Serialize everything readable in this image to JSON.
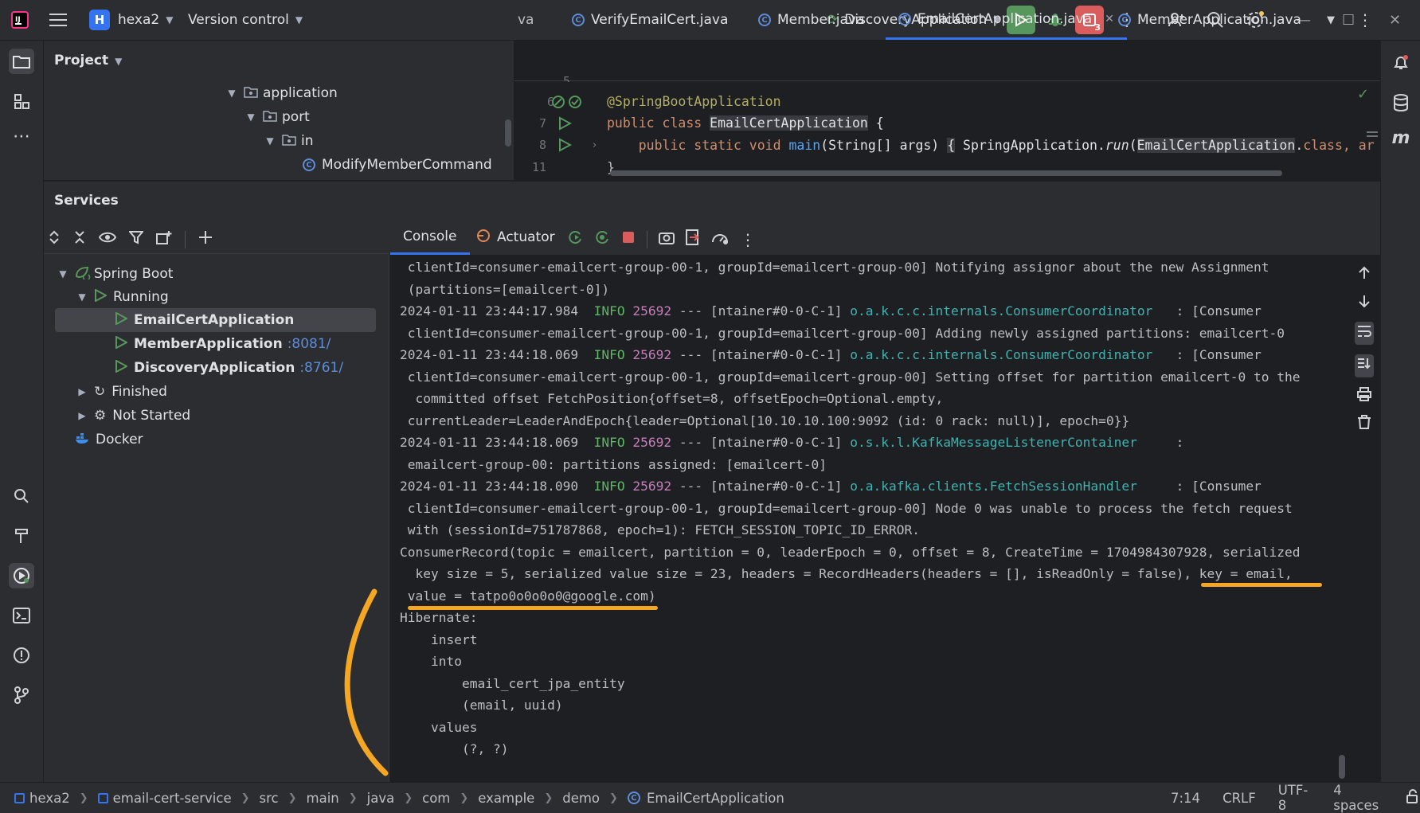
{
  "titlebar": {
    "project_letter": "H",
    "project_name": "hexa2",
    "vcs_label": "Version control",
    "run_config": "DiscoveryApplication",
    "stop_count": "3"
  },
  "project_panel": {
    "title": "Project",
    "rows": [
      "application",
      "port",
      "in",
      "ModifyMemberCommand"
    ]
  },
  "editor": {
    "tabs": [
      "va",
      "VerifyEmailCert.java",
      "Member.java",
      "EmailCertApplication.java",
      "MemberApplication.java"
    ],
    "line_numbers": [
      "5",
      "6",
      "7",
      "8",
      "11"
    ],
    "lines": {
      "l6": "@SpringBootApplication",
      "l7_kw": "public class ",
      "l7_cls": "EmailCertApplication",
      "l7_rest": " {",
      "l8_kw": "    public static void ",
      "l8_fn": "main",
      "l8_args": "(String[] args) ",
      "l8_brace": "{",
      "l8_sp": " SpringApplication.",
      "l8_run": "run",
      "l8_p": "(",
      "l8_cls": "EmailCertApplication",
      "l8_dot": ".",
      "l8_class": "class",
      "l8_end": ", ar",
      "l11": "}"
    }
  },
  "services": {
    "title": "Services",
    "tree": {
      "spring_boot": "Spring Boot",
      "running": "Running",
      "apps": [
        {
          "name": "EmailCertApplication",
          "port": ""
        },
        {
          "name": "MemberApplication",
          "port": ":8081/"
        },
        {
          "name": "DiscoveryApplication",
          "port": ":8761/"
        }
      ],
      "finished": "Finished",
      "not_started": "Not Started",
      "docker": "Docker"
    },
    "console_tabs": {
      "console": "Console",
      "actuator": "Actuator"
    },
    "log": [
      {
        "text": " clientId=consumer-emailcert-group-00-1, groupId=emailcert-group-00] Notifying assignor about the new Assignment"
      },
      {
        "text": " (partitions=[emailcert-0])"
      },
      {
        "ts": "2024-01-11 23:44:17.984",
        "level": "INFO",
        "pid": "25692",
        "thread": " --- [ntainer#0-0-C-1] ",
        "cls": "o.a.k.c.c.internals.ConsumerCoordinator",
        "msg": "   : [Consumer"
      },
      {
        "text": " clientId=consumer-emailcert-group-00-1, groupId=emailcert-group-00] Adding newly assigned partitions: emailcert-0"
      },
      {
        "ts": "2024-01-11 23:44:18.069",
        "level": "INFO",
        "pid": "25692",
        "thread": " --- [ntainer#0-0-C-1] ",
        "cls": "o.a.k.c.c.internals.ConsumerCoordinator",
        "msg": "   : [Consumer"
      },
      {
        "text": " clientId=consumer-emailcert-group-00-1, groupId=emailcert-group-00] Setting offset for partition emailcert-0 to the"
      },
      {
        "text": "  committed offset FetchPosition{offset=8, offsetEpoch=Optional.empty,"
      },
      {
        "text": " currentLeader=LeaderAndEpoch{leader=Optional[10.10.10.100:9092 (id: 0 rack: null)], epoch=0}}"
      },
      {
        "ts": "2024-01-11 23:44:18.069",
        "level": "INFO",
        "pid": "25692",
        "thread": " --- [ntainer#0-0-C-1] ",
        "cls": "o.s.k.l.KafkaMessageListenerContainer",
        "msg": "     :"
      },
      {
        "text": " emailcert-group-00: partitions assigned: [emailcert-0]"
      },
      {
        "ts": "2024-01-11 23:44:18.090",
        "level": "INFO",
        "pid": "25692",
        "thread": " --- [ntainer#0-0-C-1] ",
        "cls": "o.a.kafka.clients.FetchSessionHandler",
        "msg": "     : [Consumer"
      },
      {
        "text": " clientId=consumer-emailcert-group-00-1, groupId=emailcert-group-00] Node 0 was unable to process the fetch request"
      },
      {
        "text": " with (sessionId=751787868, epoch=1): FETCH_SESSION_TOPIC_ID_ERROR."
      },
      {
        "text": "ConsumerRecord(topic = emailcert, partition = 0, leaderEpoch = 0, offset = 8, CreateTime = 1704984307928, serialized"
      },
      {
        "text": "  key size = 5, serialized value size = 23, headers = RecordHeaders(headers = [], isReadOnly = false), key = email,"
      },
      {
        "text": " value = tatpo0o0o0o0@google.com)"
      },
      {
        "text": "Hibernate: "
      },
      {
        "text": "    insert "
      },
      {
        "text": "    into"
      },
      {
        "text": "        email_cert_jpa_entity"
      },
      {
        "text": "        (email, uuid) "
      },
      {
        "text": "    values"
      },
      {
        "text": "        (?, ?)"
      }
    ]
  },
  "statusbar": {
    "crumbs": [
      "hexa2",
      "email-cert-service",
      "src",
      "main",
      "java",
      "com",
      "example",
      "demo",
      "EmailCertApplication"
    ],
    "position": "7:14",
    "line_sep": "CRLF",
    "encoding": "UTF-8",
    "indent": "4 spaces"
  },
  "colors": {
    "accent": "#3574f0",
    "run_green": "#57965c",
    "stop_red": "#db5c5c",
    "annotation": "#f5a623",
    "log_info": "#5fb865",
    "log_class": "#3fb3b0"
  }
}
